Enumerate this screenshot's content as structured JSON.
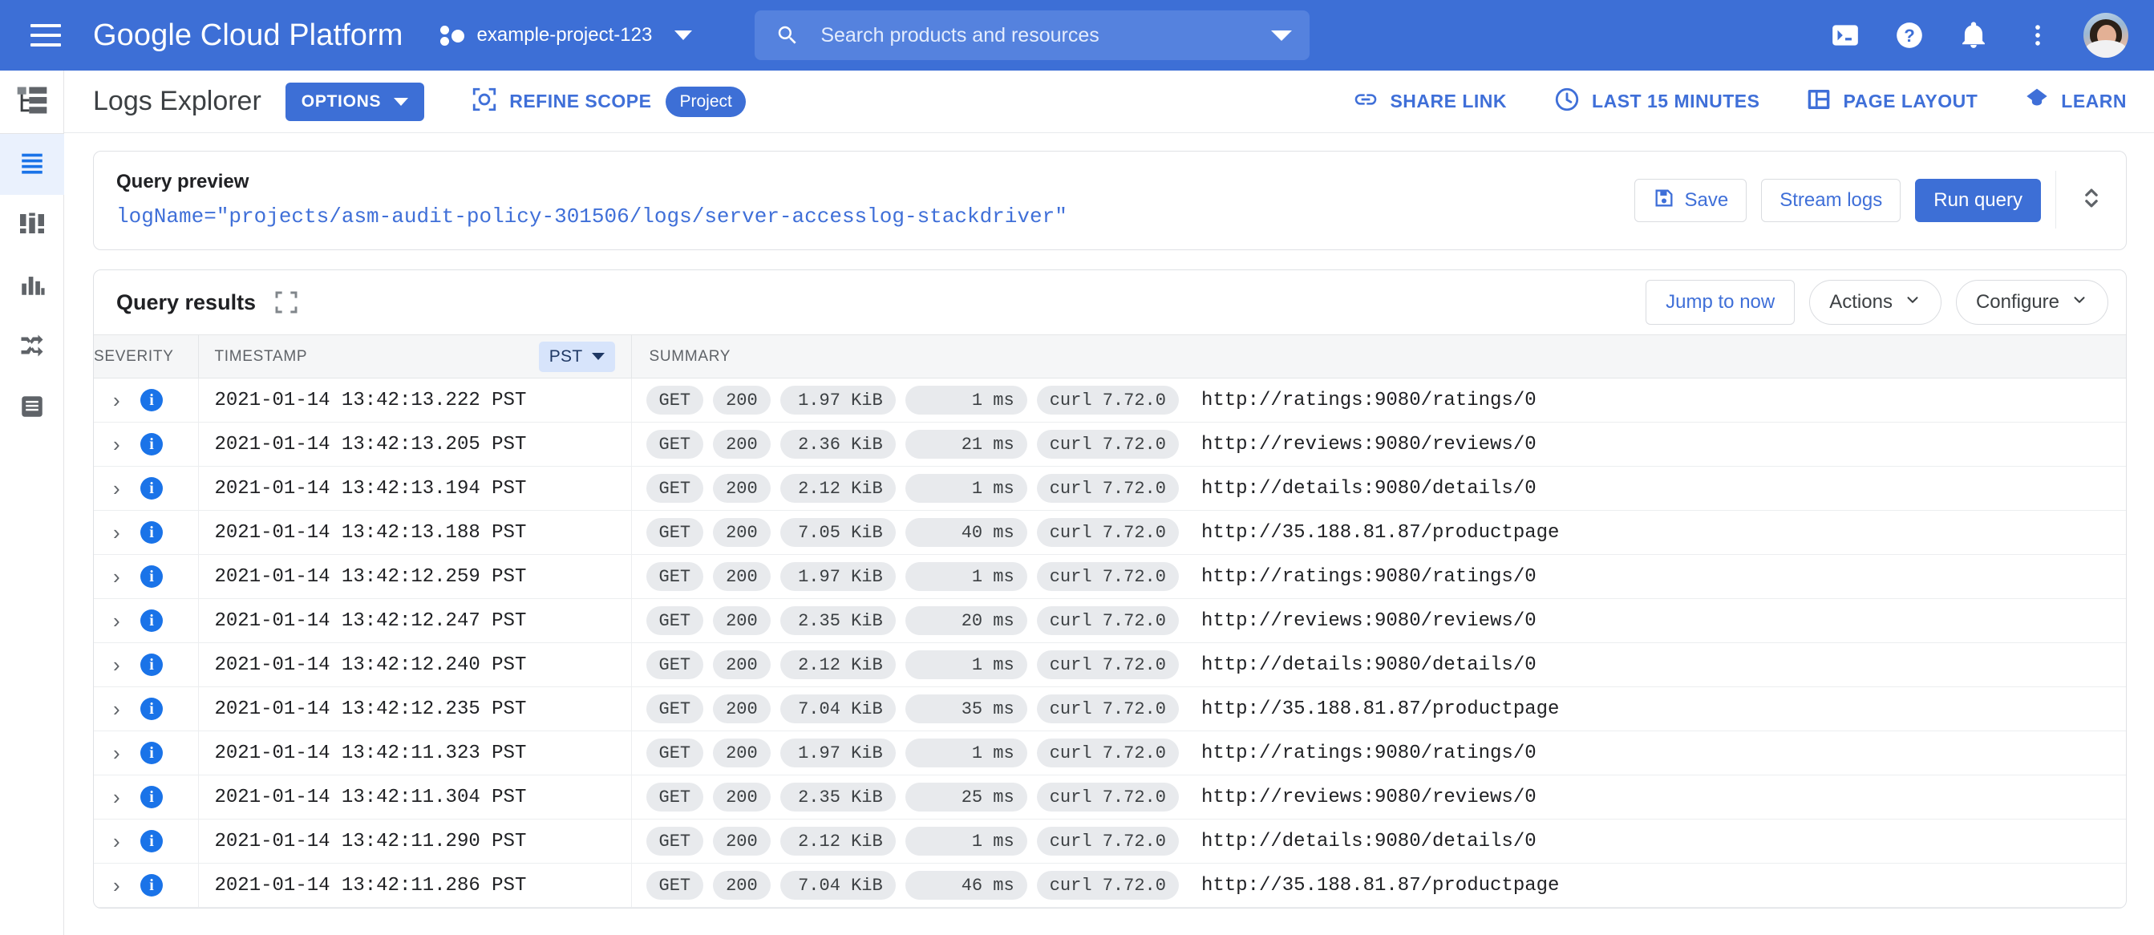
{
  "colors": {
    "brand_blue": "#3d6fd6",
    "link_blue": "#3f6fd8",
    "severity_info": "#1a73e8",
    "chip_bg": "#e8eaed",
    "tz_chip_bg": "#d7e4fb"
  },
  "topbar": {
    "menu_label": "Main menu",
    "brand": "Google Cloud Platform",
    "project": "example-project-123",
    "search_placeholder": "Search products and resources",
    "icons": [
      "cloud-shell-icon",
      "help-icon",
      "notifications-icon",
      "more-options-icon",
      "avatar"
    ]
  },
  "rail": {
    "items": [
      {
        "name": "resource-tree-icon",
        "label": "Resource tree"
      },
      {
        "name": "logs-explorer-icon",
        "label": "Logs Explorer",
        "active": true
      },
      {
        "name": "logs-dashboard-icon",
        "label": "Logs Dashboard"
      },
      {
        "name": "logs-metrics-icon",
        "label": "Logs-based Metrics"
      },
      {
        "name": "logs-router-icon",
        "label": "Logs Router"
      },
      {
        "name": "logs-storage-icon",
        "label": "Logs Storage"
      }
    ]
  },
  "toolbar": {
    "title": "Logs Explorer",
    "options_label": "OPTIONS",
    "refine_scope_label": "REFINE SCOPE",
    "scope_pill": "Project",
    "share_link_label": "SHARE LINK",
    "time_range_label": "LAST 15 MINUTES",
    "page_layout_label": "PAGE LAYOUT",
    "learn_label": "LEARN"
  },
  "query_preview": {
    "label": "Query preview",
    "query": "logName=\"projects/asm-audit-policy-301506/logs/server-accesslog-stackdriver\"",
    "save_label": "Save",
    "stream_logs_label": "Stream logs",
    "run_query_label": "Run query",
    "expander_icon": "expand-collapse-icon"
  },
  "query_results": {
    "title": "Query results",
    "expand_icon": "fullscreen-icon",
    "jump_to_now_label": "Jump to now",
    "actions_label": "Actions",
    "configure_label": "Configure",
    "columns": {
      "severity": "SEVERITY",
      "timestamp": "TIMESTAMP",
      "timezone": "PST",
      "summary": "SUMMARY"
    },
    "rows": [
      {
        "severity": "INFO",
        "timestamp": "2021-01-14 13:42:13.222 PST",
        "method": "GET",
        "status": "200",
        "size": "1.97 KiB",
        "latency": "1 ms",
        "agent": "curl 7.72.0",
        "url": "http://ratings:9080/ratings/0"
      },
      {
        "severity": "INFO",
        "timestamp": "2021-01-14 13:42:13.205 PST",
        "method": "GET",
        "status": "200",
        "size": "2.36 KiB",
        "latency": "21 ms",
        "agent": "curl 7.72.0",
        "url": "http://reviews:9080/reviews/0"
      },
      {
        "severity": "INFO",
        "timestamp": "2021-01-14 13:42:13.194 PST",
        "method": "GET",
        "status": "200",
        "size": "2.12 KiB",
        "latency": "1 ms",
        "agent": "curl 7.72.0",
        "url": "http://details:9080/details/0"
      },
      {
        "severity": "INFO",
        "timestamp": "2021-01-14 13:42:13.188 PST",
        "method": "GET",
        "status": "200",
        "size": "7.05 KiB",
        "latency": "40 ms",
        "agent": "curl 7.72.0",
        "url": "http://35.188.81.87/productpage"
      },
      {
        "severity": "INFO",
        "timestamp": "2021-01-14 13:42:12.259 PST",
        "method": "GET",
        "status": "200",
        "size": "1.97 KiB",
        "latency": "1 ms",
        "agent": "curl 7.72.0",
        "url": "http://ratings:9080/ratings/0"
      },
      {
        "severity": "INFO",
        "timestamp": "2021-01-14 13:42:12.247 PST",
        "method": "GET",
        "status": "200",
        "size": "2.35 KiB",
        "latency": "20 ms",
        "agent": "curl 7.72.0",
        "url": "http://reviews:9080/reviews/0"
      },
      {
        "severity": "INFO",
        "timestamp": "2021-01-14 13:42:12.240 PST",
        "method": "GET",
        "status": "200",
        "size": "2.12 KiB",
        "latency": "1 ms",
        "agent": "curl 7.72.0",
        "url": "http://details:9080/details/0"
      },
      {
        "severity": "INFO",
        "timestamp": "2021-01-14 13:42:12.235 PST",
        "method": "GET",
        "status": "200",
        "size": "7.04 KiB",
        "latency": "35 ms",
        "agent": "curl 7.72.0",
        "url": "http://35.188.81.87/productpage"
      },
      {
        "severity": "INFO",
        "timestamp": "2021-01-14 13:42:11.323 PST",
        "method": "GET",
        "status": "200",
        "size": "1.97 KiB",
        "latency": "1 ms",
        "agent": "curl 7.72.0",
        "url": "http://ratings:9080/ratings/0"
      },
      {
        "severity": "INFO",
        "timestamp": "2021-01-14 13:42:11.304 PST",
        "method": "GET",
        "status": "200",
        "size": "2.35 KiB",
        "latency": "25 ms",
        "agent": "curl 7.72.0",
        "url": "http://reviews:9080/reviews/0"
      },
      {
        "severity": "INFO",
        "timestamp": "2021-01-14 13:42:11.290 PST",
        "method": "GET",
        "status": "200",
        "size": "2.12 KiB",
        "latency": "1 ms",
        "agent": "curl 7.72.0",
        "url": "http://details:9080/details/0"
      },
      {
        "severity": "INFO",
        "timestamp": "2021-01-14 13:42:11.286 PST",
        "method": "GET",
        "status": "200",
        "size": "7.04 KiB",
        "latency": "46 ms",
        "agent": "curl 7.72.0",
        "url": "http://35.188.81.87/productpage"
      }
    ]
  }
}
